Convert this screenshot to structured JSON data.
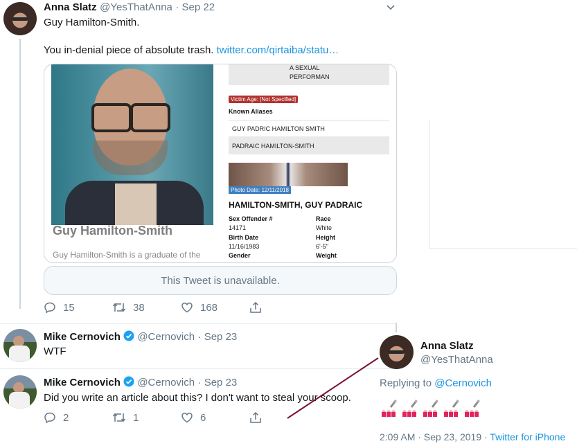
{
  "tweet1": {
    "name": "Anna Slatz",
    "handle": "@YesThatAnna",
    "date": "· Sep 22",
    "line1": "Guy Hamilton-Smith.",
    "line2": "You in-denial piece of absolute trash.",
    "link": "twitter.com/qirtaiba/statu…",
    "card": {
      "photo_caption": "Guy Hamilton-Smith",
      "photo_subcaption": "Guy Hamilton-Smith is a graduate of the",
      "top_text_1": "A SEXUAL",
      "top_text_2": "PERFORMAN",
      "victim_age": "Victim Age: [Not Specified]",
      "known_aliases_label": "Known Aliases",
      "alias1": "GUY PADRIC HAMILTON SMITH",
      "alias2": "PADRAIC HAMILTON-SMITH",
      "photo_date": "Photo Date: 12/11/2018",
      "full_name": "HAMILTON-SMITH, GUY PADRAIC",
      "sex_offender_label": "Sex Offender #",
      "sex_offender_value": "14171",
      "race_label": "Race",
      "race_value": "White",
      "birth_label": "Birth Date",
      "birth_value": "11/16/1983",
      "height_label": "Height",
      "height_value": "6'-5\"",
      "gender_label": "Gender",
      "weight_label": "Weight"
    },
    "unavailable": "This Tweet is unavailable.",
    "replies": "15",
    "retweets": "38",
    "likes": "168"
  },
  "tweet2": {
    "name": "Mike Cernovich",
    "handle": "@Cernovich",
    "date": "· Sep 23",
    "text": "WTF"
  },
  "tweet3": {
    "name": "Mike Cernovich",
    "handle": "@Cernovich",
    "date": "· Sep 23",
    "text": "Did you write an article about this? I don't want to steal your scoop.",
    "replies": "2",
    "retweets": "1",
    "likes": "6"
  },
  "overlay": {
    "name": "Anna Slatz",
    "handle": "@YesThatAnna",
    "replying_label": "Replying to",
    "replying_to": "@Cernovich",
    "timestamp": "2:09 AM · Sep 23, 2019 ·",
    "source": "Twitter for iPhone"
  },
  "colors": {
    "link": "#1b95e0",
    "verified": "#1da1f2",
    "annotation_line": "#7a1030"
  }
}
